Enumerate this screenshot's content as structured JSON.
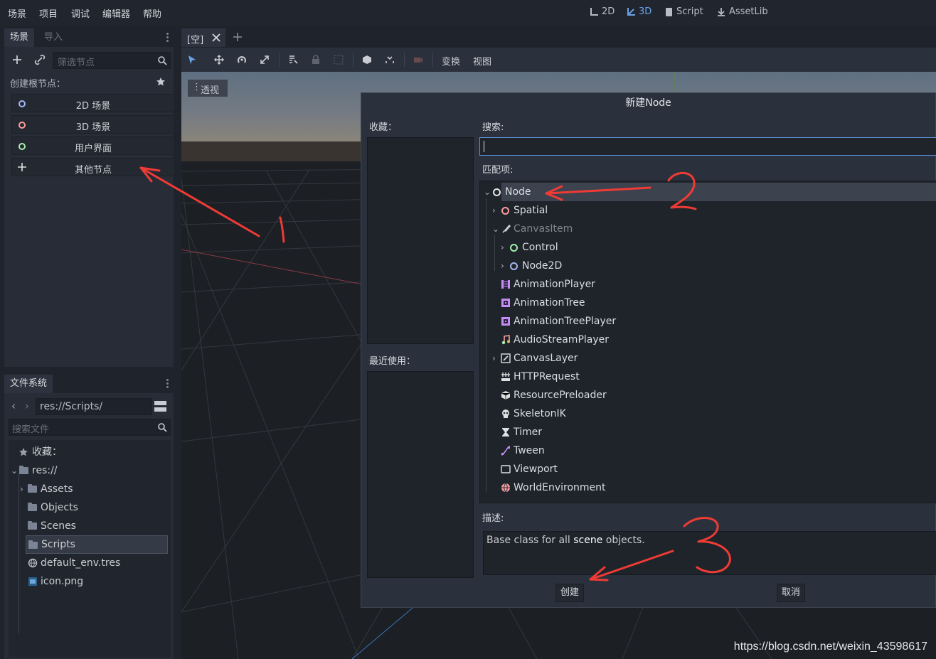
{
  "menubar": {
    "items": [
      "场景",
      "项目",
      "调试",
      "编辑器",
      "帮助"
    ],
    "workspaces": [
      "2D",
      "3D",
      "Script",
      "AssetLib"
    ],
    "active_workspace": "3D"
  },
  "scene_dock": {
    "tabs": [
      "场景",
      "导入"
    ],
    "filter_placeholder": "筛选节点",
    "create_root_label": "创建根节点：",
    "root_buttons": [
      {
        "label": "2D 场景",
        "color": "#a5b7f3"
      },
      {
        "label": "3D 场景",
        "color": "#fc9c9c"
      },
      {
        "label": "用户界面",
        "color": "#a5efac"
      },
      {
        "label": "其他节点",
        "color": "#e0e0e0"
      }
    ]
  },
  "filesystem_dock": {
    "tab": "文件系统",
    "path": "res://Scripts/",
    "search_placeholder": "搜索文件",
    "items": [
      {
        "label": "收藏：",
        "kind": "favorites"
      },
      {
        "label": "res://",
        "kind": "root"
      },
      {
        "label": "Assets",
        "kind": "folder"
      },
      {
        "label": "Objects",
        "kind": "folder"
      },
      {
        "label": "Scenes",
        "kind": "folder"
      },
      {
        "label": "Scripts",
        "kind": "folder",
        "selected": true
      },
      {
        "label": "default_env.tres",
        "kind": "resource"
      },
      {
        "label": "icon.png",
        "kind": "image"
      }
    ]
  },
  "editor_tabs": {
    "scene_tab": "[空]",
    "toolbar_menus": [
      "变换",
      "视图"
    ],
    "viewport_label": "透视"
  },
  "dialog": {
    "title": "新建Node",
    "favorites_label": "收藏：",
    "recent_label": "最近使用：",
    "search_label": "搜索:",
    "matches_label": "匹配项:",
    "description_label": "描述:",
    "description_prefix": "Base class for all ",
    "description_keyword": "scene",
    "description_suffix": " objects.",
    "create_button": "创建",
    "cancel_button": "取消",
    "tree": [
      {
        "label": "Node",
        "depth": 0,
        "icon": "ring-white",
        "expand": "open",
        "selected": true
      },
      {
        "label": "Spatial",
        "depth": 1,
        "icon": "ring-red",
        "expand": "closed"
      },
      {
        "label": "CanvasItem",
        "depth": 1,
        "icon": "brush",
        "expand": "open",
        "disabled": true
      },
      {
        "label": "Control",
        "depth": 2,
        "icon": "ring-green",
        "expand": "closed"
      },
      {
        "label": "Node2D",
        "depth": 2,
        "icon": "ring-blue",
        "expand": "closed"
      },
      {
        "label": "AnimationPlayer",
        "depth": 1,
        "icon": "film"
      },
      {
        "label": "AnimationTree",
        "depth": 1,
        "icon": "film-tree"
      },
      {
        "label": "AnimationTreePlayer",
        "depth": 1,
        "icon": "film-tree"
      },
      {
        "label": "AudioStreamPlayer",
        "depth": 1,
        "icon": "note"
      },
      {
        "label": "CanvasLayer",
        "depth": 1,
        "icon": "layer",
        "expand": "closed"
      },
      {
        "label": "HTTPRequest",
        "depth": 1,
        "icon": "http"
      },
      {
        "label": "ResourcePreloader",
        "depth": 1,
        "icon": "cube"
      },
      {
        "label": "SkeletonIK",
        "depth": 1,
        "icon": "skull"
      },
      {
        "label": "Timer",
        "depth": 1,
        "icon": "hourglass"
      },
      {
        "label": "Tween",
        "depth": 1,
        "icon": "tween"
      },
      {
        "label": "Viewport",
        "depth": 1,
        "icon": "viewport"
      },
      {
        "label": "WorldEnvironment",
        "depth": 1,
        "icon": "globe"
      }
    ]
  },
  "annotations": [
    "1",
    "2",
    "3"
  ],
  "watermark": "https://blog.csdn.net/weixin_43598617"
}
